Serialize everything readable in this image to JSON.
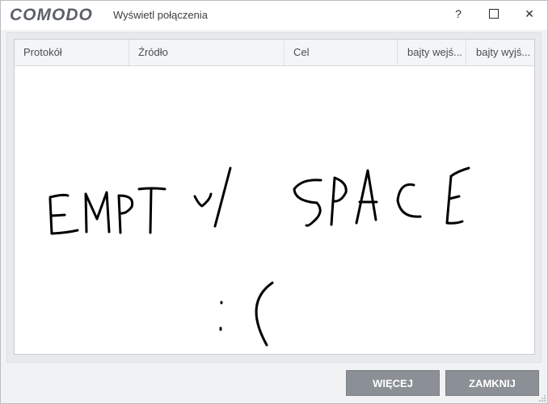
{
  "window": {
    "brand": "COMODO",
    "title": "Wyświetl połączenia",
    "controls": {
      "help": "?",
      "maximize": "",
      "close": "✕"
    }
  },
  "table": {
    "columns": [
      "Protokół",
      "Źródło",
      "Cel",
      "bajty wejś...",
      "bajty wyjś..."
    ],
    "rows": []
  },
  "drawing": {
    "line1": "EMPTY SPACE",
    "line2": ":("
  },
  "buttons": {
    "more": "WIĘCEJ",
    "close": "ZAMKNIJ"
  },
  "colors": {
    "button_bg": "#8b8f96",
    "header_bg": "#f4f5f7",
    "window_bg": "#f1f2f4"
  }
}
